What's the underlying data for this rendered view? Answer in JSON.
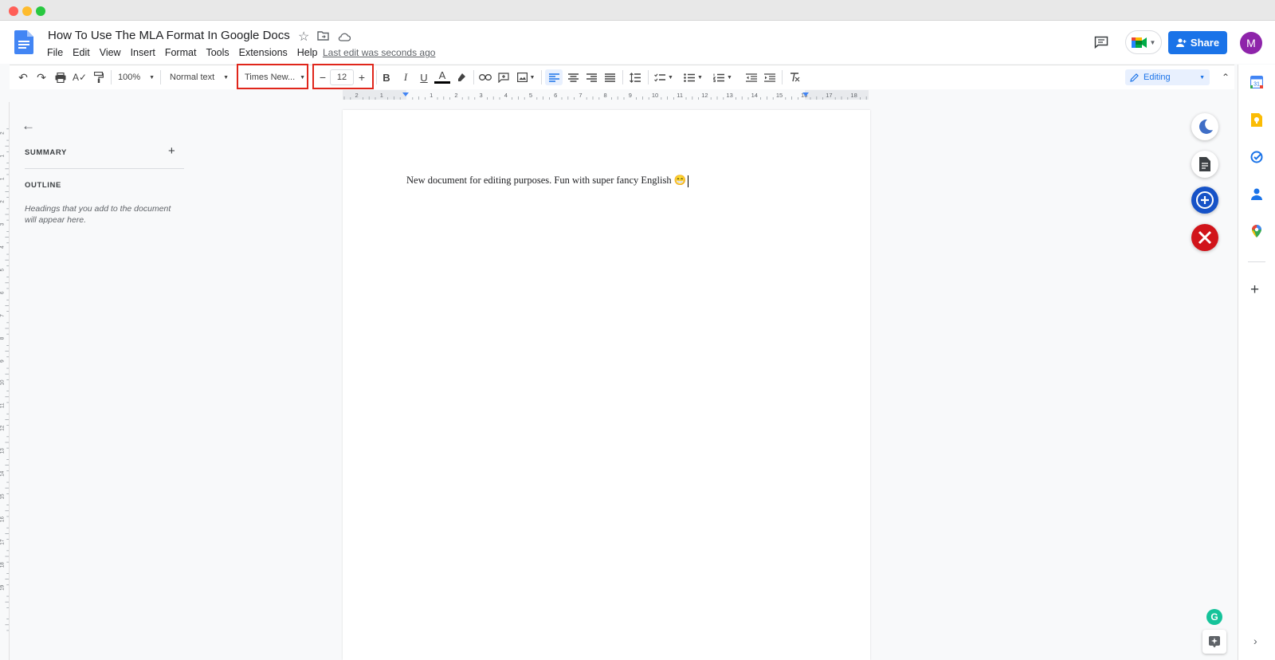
{
  "document": {
    "title": "How To Use The MLA Format In Google Docs",
    "last_edit": "Last edit was seconds ago",
    "body_text": "New document for editing purposes. Fun with super fancy English 😁"
  },
  "menu": [
    "File",
    "Edit",
    "View",
    "Insert",
    "Format",
    "Tools",
    "Extensions",
    "Help"
  ],
  "toolbar": {
    "zoom": "100%",
    "style": "Normal text",
    "font": "Times New...",
    "font_size": "12",
    "bold": "B",
    "italic": "I",
    "underline": "U",
    "text_color_letter": "A",
    "mode": "Editing"
  },
  "header": {
    "share_label": "Share",
    "avatar_letter": "M"
  },
  "sidebar": {
    "summary_label": "SUMMARY",
    "outline_label": "OUTLINE",
    "outline_hint": "Headings that you add to the document will appear here."
  },
  "ruler": {
    "top_ticks": [
      "2",
      "1",
      "1",
      "2",
      "3",
      "4",
      "5",
      "6",
      "7",
      "8",
      "9",
      "10",
      "11",
      "12",
      "13",
      "14",
      "15",
      "16",
      "17",
      "18"
    ],
    "left_ticks": [
      "2",
      "1",
      "1",
      "2",
      "3",
      "4",
      "5",
      "6",
      "7",
      "8",
      "9",
      "10",
      "11",
      "12",
      "13",
      "14",
      "15",
      "16",
      "17",
      "18",
      "19"
    ]
  },
  "colors": {
    "accent": "#1a73e8",
    "highlight_box": "#e0261b",
    "avatar": "#8e24aa"
  }
}
